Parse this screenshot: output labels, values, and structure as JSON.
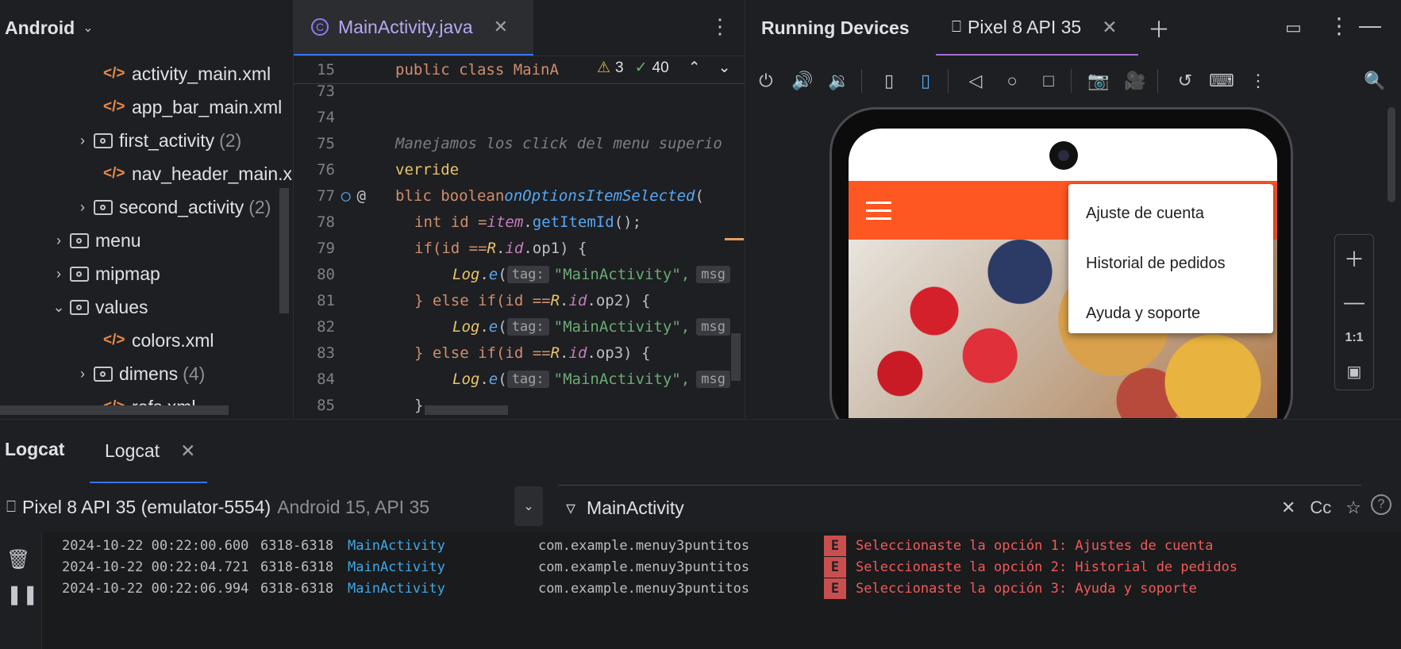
{
  "project": {
    "view_name": "Android",
    "tree": [
      {
        "label": "activity_main.xml",
        "type": "xml"
      },
      {
        "label": "app_bar_main.xml",
        "type": "xml"
      },
      {
        "label": "first_activity",
        "count": "(2)",
        "type": "folder"
      },
      {
        "label": "nav_header_main.xml",
        "type": "xml"
      },
      {
        "label": "second_activity",
        "count": "(2)",
        "type": "folder"
      },
      {
        "label": "menu",
        "type": "folder"
      },
      {
        "label": "mipmap",
        "type": "folder"
      },
      {
        "label": "values",
        "type": "folder"
      },
      {
        "label": "colors.xml",
        "type": "xml"
      },
      {
        "label": "dimens",
        "count": "(4)",
        "type": "folder"
      },
      {
        "label": "refs.xml",
        "type": "xml"
      }
    ]
  },
  "editor": {
    "tab_label": "MainActivity.java",
    "sticky_line_number": "15",
    "sticky_code": "public class MainA",
    "warnings_count": "3",
    "checks_count": "40",
    "line_numbers": [
      "73",
      "74",
      "75",
      "76",
      "77",
      "78",
      "79",
      "80",
      "81",
      "82",
      "83",
      "84",
      "85"
    ],
    "lines": {
      "l75": "Manejamos los click del menu superio",
      "l76": "verride",
      "l77a": "blic boolean ",
      "l77b": "onOptionsItemSelected",
      "l77c": "(",
      "l78a": "int id = ",
      "l78b": "item",
      "l78c": ".",
      "l78d": "getItemId",
      "l78e": "();",
      "l79a": "if(id == ",
      "l79b": "R",
      "l79c": ".",
      "l79d": "id",
      "l79e": ".op1) {",
      "log_a": "Log",
      "log_b": ".",
      "log_c": "e",
      "log_d": "(",
      "tag_hint": "tag:",
      "tag_value": "\"MainActivity\",",
      "msg_hint": "msg",
      "l81a": "} else if(id == ",
      "l81e": ".op2) {",
      "l83e": ".op3) {",
      "l85": "}"
    }
  },
  "devices": {
    "title": "Running Devices",
    "device_tab": "Pixel 8 API 35",
    "zoom_ratio": "1:1",
    "menu_items": [
      "Ajuste de cuenta",
      "Historial de pedidos",
      "Ayuda y soporte"
    ],
    "appbar_color": "#ff5722"
  },
  "logcat": {
    "title": "Logcat",
    "tab_label": "Logcat",
    "device": "Pixel 8 API 35 (emulator-5554)",
    "device_sub": "Android 15, API 35",
    "filter_value": "MainActivity",
    "match_case": "Cc",
    "entries": [
      {
        "ts": "2024-10-22 00:22:00.600",
        "pid": "6318-6318",
        "tag": "MainActivity",
        "pkg": "com.example.menuy3puntitos",
        "level": "E",
        "msg": "Seleccionaste la opción 1: Ajustes de cuenta"
      },
      {
        "ts": "2024-10-22 00:22:04.721",
        "pid": "6318-6318",
        "tag": "MainActivity",
        "pkg": "com.example.menuy3puntitos",
        "level": "E",
        "msg": "Seleccionaste la opción 2: Historial de pedidos"
      },
      {
        "ts": "2024-10-22 00:22:06.994",
        "pid": "6318-6318",
        "tag": "MainActivity",
        "pkg": "com.example.menuy3puntitos",
        "level": "E",
        "msg": "Seleccionaste la opción 3: Ayuda y soporte"
      }
    ]
  }
}
